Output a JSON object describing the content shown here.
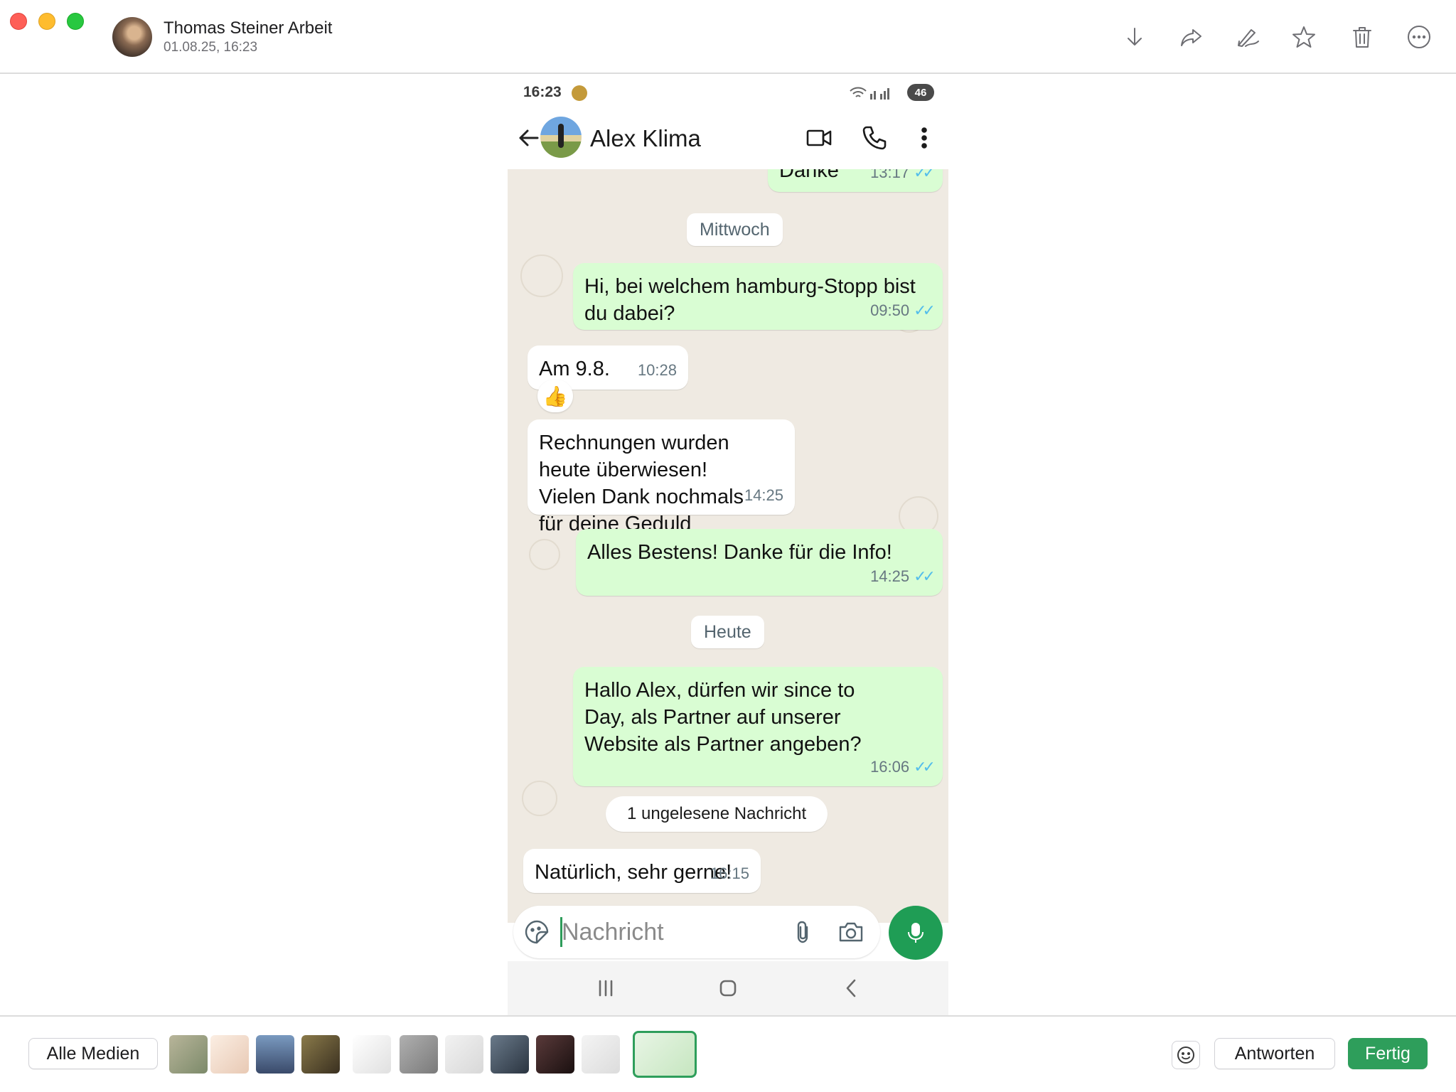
{
  "titlebar": {
    "sender_name": "Thomas Steiner Arbeit",
    "sender_date": "01.08.25, 16:23",
    "icons": [
      "download-icon",
      "share-icon",
      "markup-icon",
      "star-icon",
      "trash-icon",
      "more-icon"
    ]
  },
  "phone": {
    "status_time": "16:23",
    "battery": "46",
    "contact_name": "Alex Klima",
    "messages": [
      {
        "dir": "out",
        "text": "Danke",
        "time": "13:17",
        "ticks": "✓✓"
      },
      {
        "type": "day",
        "text": "Mittwoch"
      },
      {
        "dir": "out",
        "text": "Hi, bei welchem hamburg-Stopp bist du dabei?",
        "time": "09:50",
        "ticks": "✓✓"
      },
      {
        "dir": "in",
        "text": "Am 9.8.",
        "time": "10:28",
        "reaction": "👍"
      },
      {
        "dir": "in",
        "text": "Rechnungen wurden heute überwiesen! Vielen Dank nochmals für deine Geduld",
        "time": "14:25"
      },
      {
        "dir": "out",
        "text": "Alles Bestens! Danke für die Info!",
        "time": "14:25",
        "ticks": "✓✓"
      },
      {
        "type": "day",
        "text": "Heute"
      },
      {
        "dir": "out",
        "text": "Hallo Alex, dürfen wir since to Day, als Partner auf unserer Website als Partner angeben?",
        "time": "16:06",
        "ticks": "✓✓"
      },
      {
        "type": "unread",
        "text": "1 ungelesene Nachricht"
      },
      {
        "dir": "in",
        "text": "Natürlich, sehr gerne!",
        "time": "16:15"
      }
    ],
    "composer_placeholder": "Nachricht"
  },
  "bottombar": {
    "all_media_label": "Alle Medien",
    "reply_label": "Antworten",
    "done_label": "Fertig",
    "thumb_colors": [
      "#9aa58a",
      "#f3dccf",
      "#5a6f8a",
      "#6b5a3a",
      "#f0f0f0",
      "#9a9a9a",
      "#e6e6e6",
      "#4a5a6a",
      "#3a2a2a",
      "#e8e8e8"
    ],
    "accent": "#2e9e5b"
  }
}
